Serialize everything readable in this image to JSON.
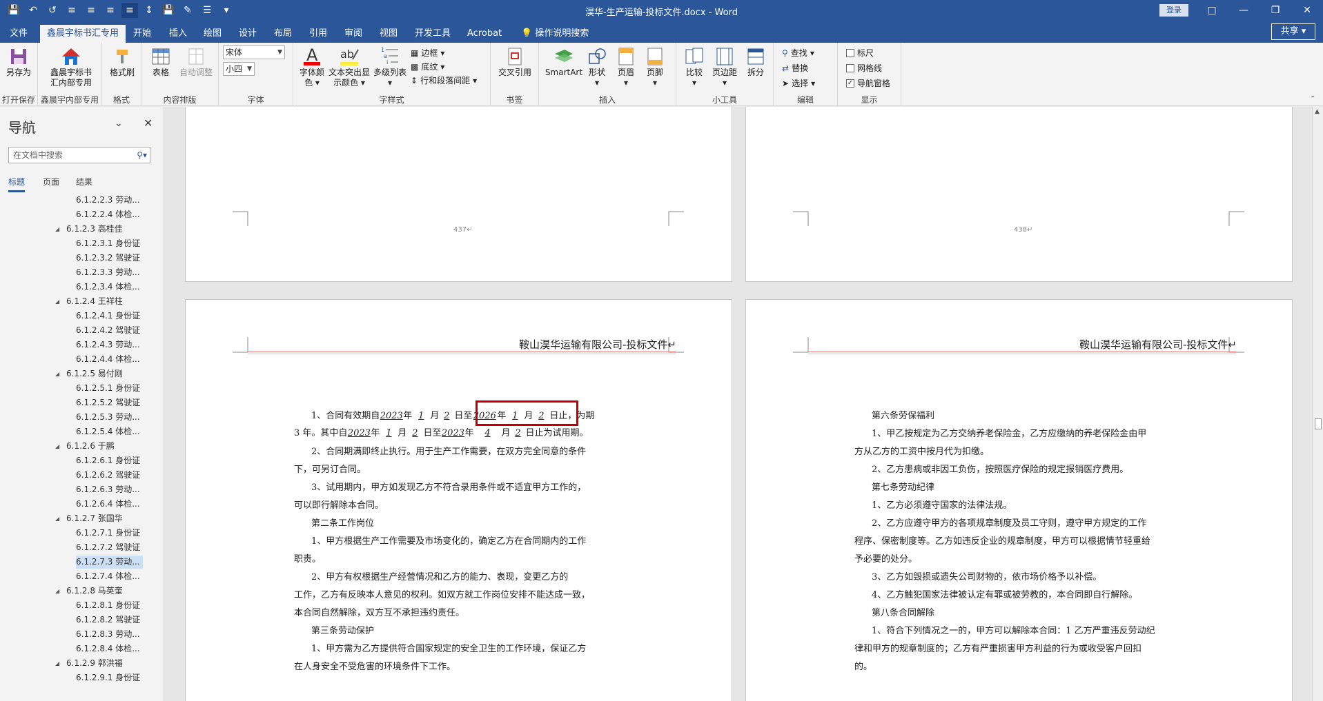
{
  "window": {
    "title": "淏华-生产运输-投标文件.docx  -  Word",
    "login": "登录",
    "share": "共享"
  },
  "tabs": [
    "文件",
    "鑫晨宇标书汇专用",
    "开始",
    "插入",
    "绘图",
    "设计",
    "布局",
    "引用",
    "审阅",
    "视图",
    "开发工具",
    "Acrobat",
    "操作说明搜索"
  ],
  "ribbon": {
    "groups": {
      "save": "打开保存",
      "xcy": "鑫晨宇内部专用",
      "format": "格式",
      "layout": "内容排版",
      "font": "字体",
      "charstyle": "字样式",
      "bookmark": "书签",
      "insert": "插入",
      "tools": "小工具",
      "edit": "编辑",
      "show": "显示"
    },
    "buttons": {
      "saveas": "另存为",
      "xcy1": "鑫晨宇标书",
      "xcy2": "汇内部专用",
      "painter": "格式刷",
      "table": "表格",
      "autofit": "自动调整",
      "fontcolor1": "字体颜",
      "fontcolor2": "色",
      "highlight1": "文本突出显",
      "highlight2": "示颜色",
      "multilist": "多级列表",
      "border": "边框",
      "shading": "底纹",
      "linespacing": "行和段落间距",
      "crossref": "交叉引用",
      "smartart": "SmartArt",
      "shape": "形状",
      "header": "页眉",
      "footer": "页脚",
      "compare": "比较",
      "margins": "页边距",
      "split": "拆分",
      "find": "查找",
      "replace": "替换",
      "select": "选择",
      "ruler": "标尺",
      "grid": "网格线",
      "navpane": "导航窗格"
    },
    "font_name": "宋体",
    "font_size": "小四"
  },
  "nav": {
    "title": "导航",
    "search_placeholder": "在文档中搜索",
    "tabs": [
      "标题",
      "页面",
      "结果"
    ],
    "tree": [
      {
        "text": "6.1.2.2.3 劳动...",
        "level": 2
      },
      {
        "text": "6.1.2.2.4 体检...",
        "level": 2
      },
      {
        "text": "6.1.2.3 高桂佳",
        "level": 1
      },
      {
        "text": "6.1.2.3.1 身份证",
        "level": 2
      },
      {
        "text": "6.1.2.3.2 驾驶证",
        "level": 2
      },
      {
        "text": "6.1.2.3.3 劳动...",
        "level": 2
      },
      {
        "text": "6.1.2.3.4 体检...",
        "level": 2
      },
      {
        "text": "6.1.2.4 王祥柱",
        "level": 1
      },
      {
        "text": "6.1.2.4.1 身份证",
        "level": 2
      },
      {
        "text": "6.1.2.4.2 驾驶证",
        "level": 2
      },
      {
        "text": "6.1.2.4.3 劳动...",
        "level": 2
      },
      {
        "text": "6.1.2.4.4 体检...",
        "level": 2
      },
      {
        "text": "6.1.2.5 易付刚",
        "level": 1
      },
      {
        "text": "6.1.2.5.1 身份证",
        "level": 2
      },
      {
        "text": "6.1.2.5.2 驾驶证",
        "level": 2
      },
      {
        "text": "6.1.2.5.3 劳动...",
        "level": 2
      },
      {
        "text": "6.1.2.5.4 体检...",
        "level": 2
      },
      {
        "text": "6.1.2.6 于鹏",
        "level": 1
      },
      {
        "text": "6.1.2.6.1 身份证",
        "level": 2
      },
      {
        "text": "6.1.2.6.2 驾驶证",
        "level": 2
      },
      {
        "text": "6.1.2.6.3 劳动...",
        "level": 2
      },
      {
        "text": "6.1.2.6.4 体检...",
        "level": 2
      },
      {
        "text": "6.1.2.7 张国华",
        "level": 1
      },
      {
        "text": "6.1.2.7.1 身份证",
        "level": 2
      },
      {
        "text": "6.1.2.7.2 驾驶证",
        "level": 2
      },
      {
        "text": "6.1.2.7.3 劳动...",
        "level": 2,
        "selected": true
      },
      {
        "text": "6.1.2.7.4 体检...",
        "level": 2
      },
      {
        "text": "6.1.2.8 马英奎",
        "level": 1
      },
      {
        "text": "6.1.2.8.1 身份证",
        "level": 2
      },
      {
        "text": "6.1.2.8.2 驾驶证",
        "level": 2
      },
      {
        "text": "6.1.2.8.3 劳动...",
        "level": 2
      },
      {
        "text": "6.1.2.8.4 体检...",
        "level": 2
      },
      {
        "text": "6.1.2.9 郭洪福",
        "level": 1
      },
      {
        "text": "6.1.2.9.1 身份证",
        "level": 2
      }
    ]
  },
  "pages": {
    "p437": "437↵",
    "p438": "438↵",
    "header": "鞍山淏华运输有限公司-投标文件↵",
    "left": {
      "l1": {
        "a": "1、合同有效期自",
        "y1": "2023",
        "b": "年",
        "m1": "1",
        "c": "月",
        "d1": "2",
        "d": "日至",
        "y2": "2026",
        "e": "年",
        "m2": "1",
        "f": "月",
        "d2": "2",
        "g": "日止，为期"
      },
      "l2": {
        "a": "3 年。其中自",
        "y1": "2023",
        "b": "年",
        "m1": "1",
        "c": "月",
        "d1": "2",
        "d": "日至",
        "y2": "2023",
        "e": "年",
        "m2": "4",
        "f": "月",
        "d2": "2",
        "g": "日止为试用期。"
      },
      "lines": [
        "2、合同期满即终止执行。用于生产工作需要，在双方完全同意的条件",
        "下，可另订合同。",
        "3、试用期内，甲方如发现乙方不符合录用条件或不适宜甲方工作的，",
        "可以即行解除本合同。",
        "第二条工作岗位",
        "1、甲方根据生产工作需要及市场变化的，确定乙方在合同期内的工作",
        "职责。",
        "2、甲方有权根据生产经营情况和乙方的能力、表现，变更乙方的",
        "工作，乙方有反映本人意见的权利。如双方就工作岗位安排不能达成一致，",
        "本合同自然解除，双方互不承担违约责任。",
        "第三条劳动保护",
        "1、甲方需为乙方提供符合国家规定的安全卫生的工作环境，保证乙方",
        "在人身安全不受危害的环境条件下工作。"
      ]
    },
    "right": {
      "lines": [
        "第六条劳保福利",
        "1、甲乙按规定为乙方交纳养老保险金，乙方应缴纳的养老保险金由甲",
        "方从乙方的工资中按月代为扣缴。",
        "2、乙方患病或非因工负伤，按照医疗保险的规定报销医疗费用。",
        "第七条劳动纪律",
        "1、乙方必须遵守国家的法律法规。",
        "2、乙方应遵守甲方的各项规章制度及员工守则，遵守甲方规定的工作",
        "程序、保密制度等。乙方如违反企业的规章制度，甲方可以根据情节轻重给",
        "予必要的处分。",
        "3、乙方如毁损或遗失公司财物的，依市场价格予以补偿。",
        "4、乙方触犯国家法律被认定有罪或被劳教的，本合同即自行解除。",
        "第八条合同解除",
        "1、符合下列情况之一的，甲方可以解除本合同：1 乙方严重违反劳动纪",
        "律和甲方的规章制度的；乙方有严重损害甲方利益的行为或收受客户回扣",
        "的。"
      ]
    }
  }
}
